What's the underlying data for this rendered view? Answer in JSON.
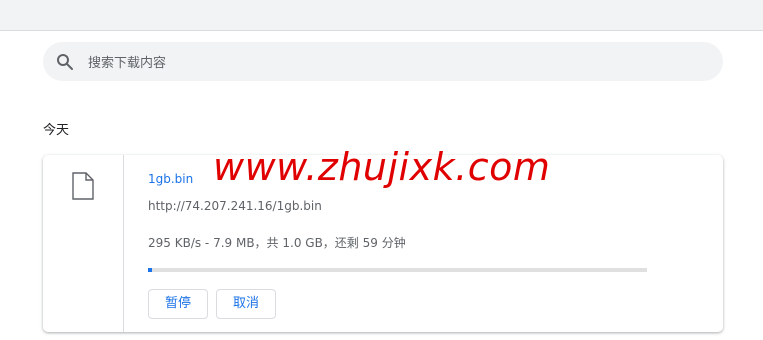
{
  "search": {
    "placeholder": "搜索下载内容"
  },
  "section": {
    "title": "今天"
  },
  "download": {
    "file_name": "1gb.bin",
    "url": "http://74.207.241.16/1gb.bin",
    "status": "295 KB/s - 7.9 MB，共 1.0 GB，还剩 59 分钟",
    "progress_fraction": 0.0079,
    "pause_label": "暂停",
    "cancel_label": "取消",
    "icon": "file-icon"
  },
  "watermark": {
    "text": "www.zhujixk.com"
  },
  "colors": {
    "accent": "#1a73e8",
    "watermark": "#e00000",
    "topbar": "#f1f3f4"
  }
}
